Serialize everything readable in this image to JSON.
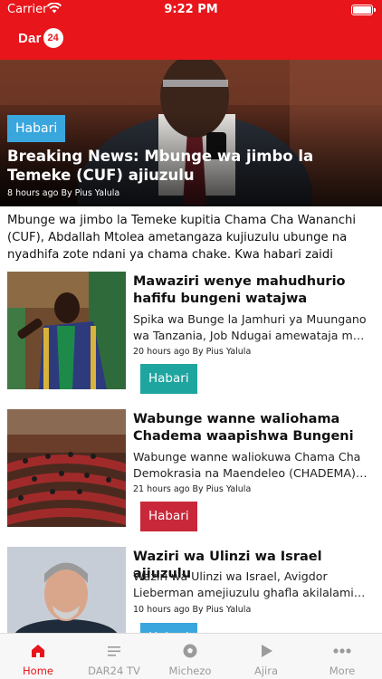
{
  "status_bar": {
    "carrier": "Carrier",
    "time": "9:22 PM"
  },
  "header": {
    "logo_text": "Dar",
    "logo_badge": "24",
    "brand_color": "#e8151b"
  },
  "hero": {
    "tag": "Habari",
    "tag_color": "#3aa6de",
    "title": "Breaking News: Mbunge wa jimbo la Temeke (CUF) ajiuzulu",
    "meta": "8 hours ago By Pius Yalula",
    "lead": "Mbunge wa jimbo la Temeke kupitia Chama Cha Wananchi (CUF), Abdallah Mtolea ametangaza kujiuzulu ubunge na nyadhifa zote ndani ya chama chake. Kwa habari zaidi endele…"
  },
  "articles": [
    {
      "title": "Mawaziri wenye mahudhurio hafifu bungeni watajwa",
      "desc": "Spika wa Bunge la Jamhuri ya Muungano wa Tanzania, Job Ndugai amewataja m…",
      "meta": "20 hours ago By Pius Yalula",
      "tag": "Habari",
      "tag_color": "#1fa5a0"
    },
    {
      "title": "Wabunge wanne waliohama Chadema waapishwa Bungeni",
      "desc": "Wabunge wanne waliokuwa Chama Cha Demokrasia na Maendeleo (CHADEMA)…",
      "meta": "21 hours ago By Pius Yalula",
      "tag": "Habari",
      "tag_color": "#c8283a"
    },
    {
      "title": "Waziri wa Ulinzi wa Israel ajiuzulu",
      "desc": "Waziri wa Ulinzi wa Israel, Avigdor Lieberman amejiuzulu ghafla akilalami…",
      "meta": "10 hours ago By Pius Yalula",
      "tag": "Habari",
      "tag_color": "#3aa6de"
    }
  ],
  "tabs": [
    {
      "label": "Home",
      "icon": "home-icon",
      "active": true
    },
    {
      "label": "DAR24 TV",
      "icon": "list-icon",
      "active": false
    },
    {
      "label": "Michezo",
      "icon": "football-icon",
      "active": false
    },
    {
      "label": "Ajira",
      "icon": "play-icon",
      "active": false
    },
    {
      "label": "More",
      "icon": "more-icon",
      "active": false
    }
  ]
}
